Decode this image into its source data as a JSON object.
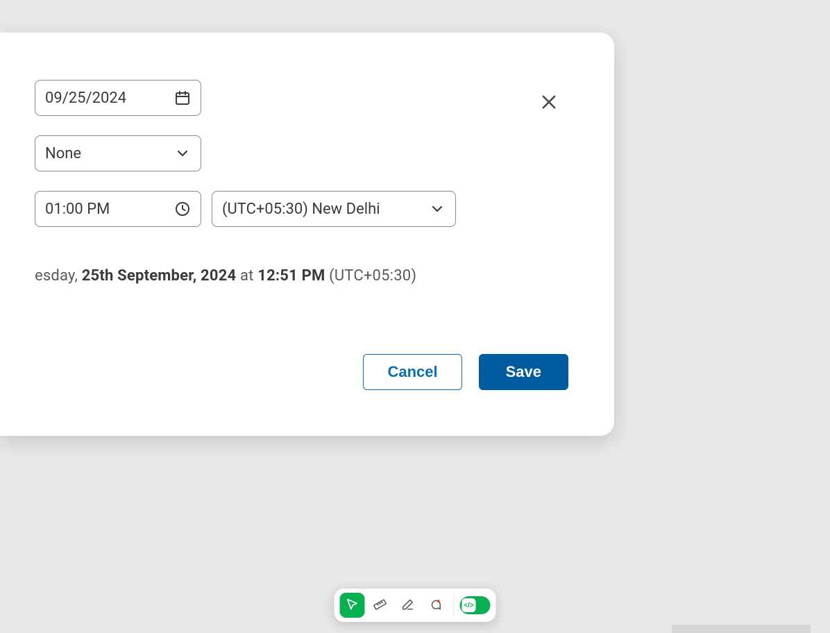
{
  "dialog": {
    "date_value": "09/25/2024",
    "select_value": "None",
    "time_value": "01:00 PM",
    "timezone_value": "(UTC+05:30) New Delhi",
    "summary_prefix": "esday, ",
    "summary_date": "25th September, 2024",
    "summary_at": " at ",
    "summary_time": "12:51 PM",
    "summary_tz": " (UTC+05:30)",
    "cancel_label": "Cancel",
    "save_label": "Save"
  },
  "toolbar": {
    "toggle_glyph": "</>"
  }
}
